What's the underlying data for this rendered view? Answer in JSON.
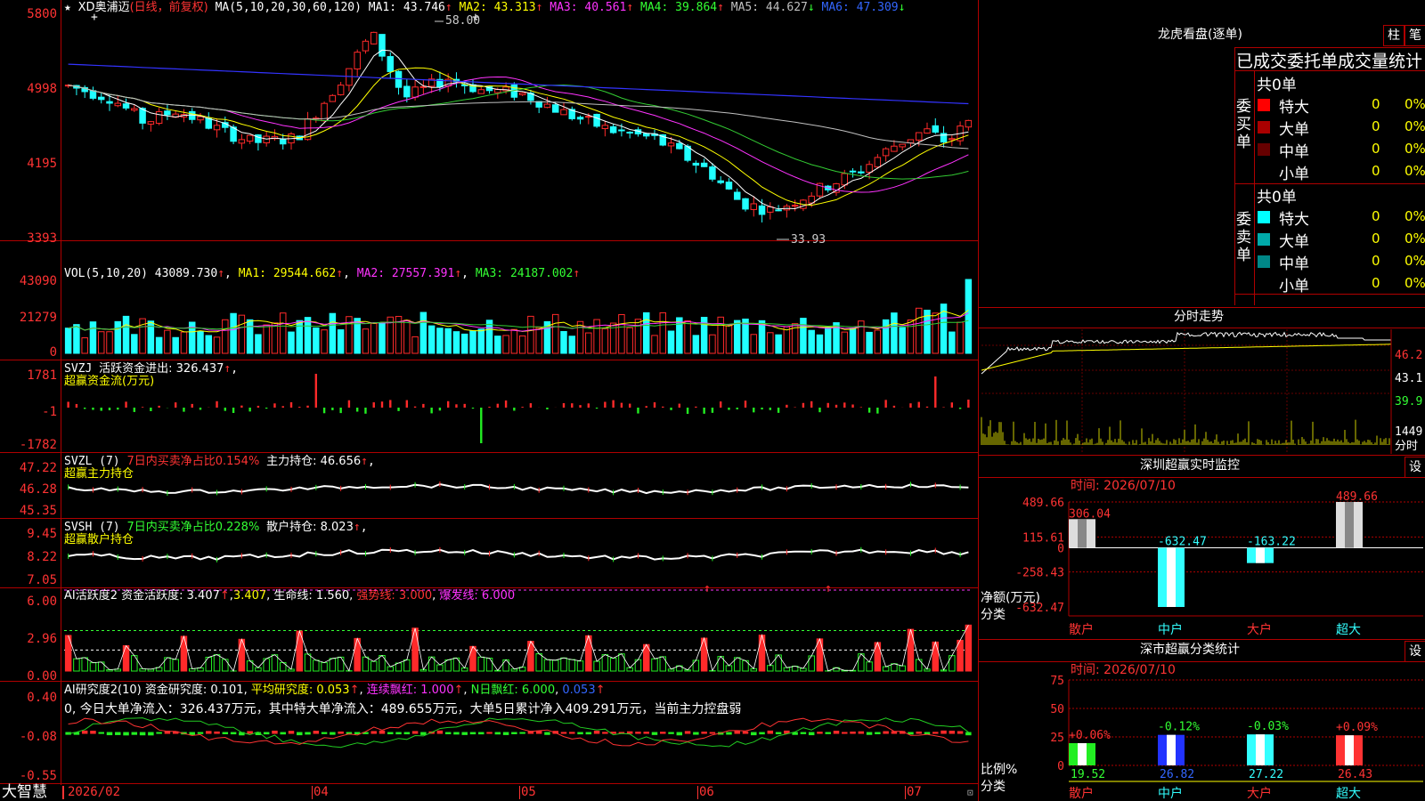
{
  "colors": {
    "up": "#ff2a2a",
    "down": "#21ffff",
    "ma1": "#ffffff",
    "ma2": "#ffff00",
    "ma3": "#ff33ff",
    "ma4": "#33cc33",
    "ma5": "#c0c0c0",
    "ma6": "#3333ff",
    "panel_border": "#b00000"
  },
  "header": {
    "star": "★",
    "plus": "+",
    "stock": "XD奥浦迈",
    "mode": "(日线，前复权)",
    "ma_def": "MA(5,10,20,30,60,120)",
    "ma1": "MA1: 43.746",
    "ma2": "MA2: 43.313",
    "ma3": "MA3: 40.561",
    "ma4": "MA4: 39.864",
    "ma5": "MA5: 44.627",
    "ma6": "MA6: 47.309",
    "arrow_up": "↑",
    "arrow_down": "↓"
  },
  "price_axis": [
    "5800",
    "4998",
    "4195",
    "3393"
  ],
  "price_marks": {
    "high": "58.00",
    "low": "33.93"
  },
  "vol_panel": {
    "title": "VOL(5,10,20)",
    "vol": "43089.730",
    "ma1": "MA1: 29544.662",
    "ma2": "MA2: 27557.391",
    "ma3": "MA3: 24187.002",
    "axis": [
      "43090",
      "21279",
      "0"
    ]
  },
  "svzj": {
    "title": "SVZJ",
    "label": "活跃资金进出: 326.437",
    "sub": "超赢资金流(万元)",
    "axis": [
      "1781",
      "-1",
      "-1782"
    ]
  },
  "svzl": {
    "title": "SVZL (7)",
    "ratio": "7日内买卖净占比0.154%",
    "hold": "主力持仓: 46.656",
    "sub": "超赢主力持仓",
    "axis": [
      "47.22",
      "46.28",
      "45.35"
    ]
  },
  "svsh": {
    "title": "SVSH (7)",
    "ratio": "7日内买卖净占比0.228%",
    "hold": "散户持仓: 8.023",
    "sub": "超赢散户持仓",
    "axis": [
      "9.45",
      "8.22",
      "7.05"
    ]
  },
  "ai1": {
    "title": "AI活跃度2",
    "a": "资金活跃度: 3.407",
    "b": "3.407",
    "c": "生命线: 1.560",
    "d": "强势线: 3.000",
    "e": "爆发线: 6.000",
    "axis": [
      "6.00",
      "2.96",
      "0.00"
    ]
  },
  "ai2": {
    "title": "AI研究度2(10)",
    "a": "资金研究度: 0.101",
    "b": "平均研究度: 0.053",
    "c": "连续飘红: 1.000",
    "d": "N日飘红: 6.000",
    "e": "0.053",
    "note": "0, 今日大单净流入：326.437万元，其中特大单净流入：489.655万元，大单5日累计净入409.291万元，当前主力控盘弱",
    "axis": [
      "0.40",
      "-0.08",
      "-0.55"
    ]
  },
  "bottom": {
    "brand": "大智慧",
    "dates": [
      "2026/02",
      "04",
      "05",
      "06",
      "07"
    ]
  },
  "right": {
    "lhb_title": "龙虎看盘(逐单)",
    "btn1": "柱",
    "btn2": "笔",
    "stats_title": "已成交委托单成交量统计",
    "buy": {
      "side": "委买单",
      "total": "共0单",
      "rows": [
        {
          "name": "特大",
          "vol": "0",
          "pct": "0%",
          "color": "#ff0000"
        },
        {
          "name": "大单",
          "vol": "0",
          "pct": "0%",
          "color": "#aa0000"
        },
        {
          "name": "中单",
          "vol": "0",
          "pct": "0%",
          "color": "#660000"
        },
        {
          "name": "小单",
          "vol": "0",
          "pct": "0%",
          "color": ""
        }
      ]
    },
    "sell": {
      "side": "委卖单",
      "total": "共0单",
      "rows": [
        {
          "name": "特大",
          "vol": "0",
          "pct": "0%",
          "color": "#00ffff"
        },
        {
          "name": "大单",
          "vol": "0",
          "pct": "0%",
          "color": "#00aaaa"
        },
        {
          "name": "中单",
          "vol": "0",
          "pct": "0%",
          "color": "#008888"
        },
        {
          "name": "小单",
          "vol": "0",
          "pct": "0%",
          "color": ""
        }
      ]
    },
    "fs_title": "分时走势",
    "fs_axis": [
      "46.2",
      "43.1",
      "39.9"
    ],
    "fs_vol": "1449",
    "fs_vol_label": "分时",
    "sz_title": "深圳超赢实时监控",
    "sz_set": "设",
    "sz_time": "时间: 2026/07/10",
    "sz_axis": [
      "489.66",
      "115.61",
      "0",
      "-258.43",
      "-632.47"
    ],
    "sz_ylabel": "净额(万元)",
    "sz_xlabel": "分类",
    "sz_cats": [
      "散户",
      "中户",
      "大户",
      "超大"
    ],
    "sz_values": [
      "306.04",
      "-632.47",
      "-163.22",
      "489.66"
    ],
    "cls_title": "深市超赢分类统计",
    "cls_set": "设",
    "cls_time": "时间: 2026/07/10",
    "cls_axis": [
      "75",
      "50",
      "25",
      "0"
    ],
    "cls_ylabel": "比例%",
    "cls_xlabel": "分类",
    "cls_changes": [
      "+0.06%",
      "-0.12%",
      "-0.03%",
      "+0.09%"
    ],
    "cls_values": [
      "19.52",
      "26.82",
      "27.22",
      "26.43"
    ],
    "cls_cats": [
      "散户",
      "中户",
      "大户",
      "超大"
    ]
  },
  "chart_data": [
    {
      "type": "candlestick",
      "title": "XD奥浦迈",
      "y_axis_ticks": [
        "5800",
        "4998",
        "4195",
        "3393"
      ],
      "high_mark": 58.0,
      "low_mark": 33.93,
      "x_ticks": [
        "2026/02",
        "04",
        "05",
        "06",
        "07"
      ],
      "ma_last": {
        "MA1": 43.746,
        "MA2": 43.313,
        "MA3": 40.561,
        "MA4": 39.864,
        "MA5": 44.627,
        "MA6": 47.309
      }
    },
    {
      "type": "bar",
      "title": "VOL(5,10,20)",
      "last": 43089.73,
      "ma": {
        "MA1": 29544.662,
        "MA2": 27557.391,
        "MA3": 24187.002
      },
      "ylim": [
        0,
        43090
      ]
    },
    {
      "type": "bar",
      "title": "SVZJ",
      "last": 326.437,
      "ylim": [
        -1782,
        1781
      ]
    },
    {
      "type": "line",
      "title": "SVZL (7)",
      "last": 46.656,
      "ylim": [
        45.35,
        47.22
      ]
    },
    {
      "type": "line",
      "title": "SVSH (7)",
      "last": 8.023,
      "ylim": [
        7.05,
        9.45
      ]
    },
    {
      "type": "bar",
      "title": "AI活跃度2",
      "last": 3.407,
      "lines": {
        "生命线": 1.56,
        "强势线": 3.0,
        "爆发线": 6.0
      },
      "ylim": [
        0,
        6
      ]
    },
    {
      "type": "bar",
      "title": "AI研究度2(10)",
      "last": 0.101,
      "avg": 0.053,
      "ylim": [
        -0.55,
        0.4
      ]
    },
    {
      "type": "bar",
      "title": "深圳超赢实时监控",
      "categories": [
        "散户",
        "中户",
        "大户",
        "超大"
      ],
      "values": [
        306.04,
        -632.47,
        -163.22,
        489.66
      ],
      "ylim": [
        -632.47,
        489.66
      ]
    },
    {
      "type": "bar",
      "title": "深市超赢分类统计",
      "categories": [
        "散户",
        "中户",
        "大户",
        "超大"
      ],
      "values": [
        19.52,
        26.82,
        27.22,
        26.43
      ],
      "changes": [
        "+0.06%",
        "-0.12%",
        "-0.03%",
        "+0.09%"
      ],
      "ylim": [
        0,
        75
      ]
    }
  ]
}
